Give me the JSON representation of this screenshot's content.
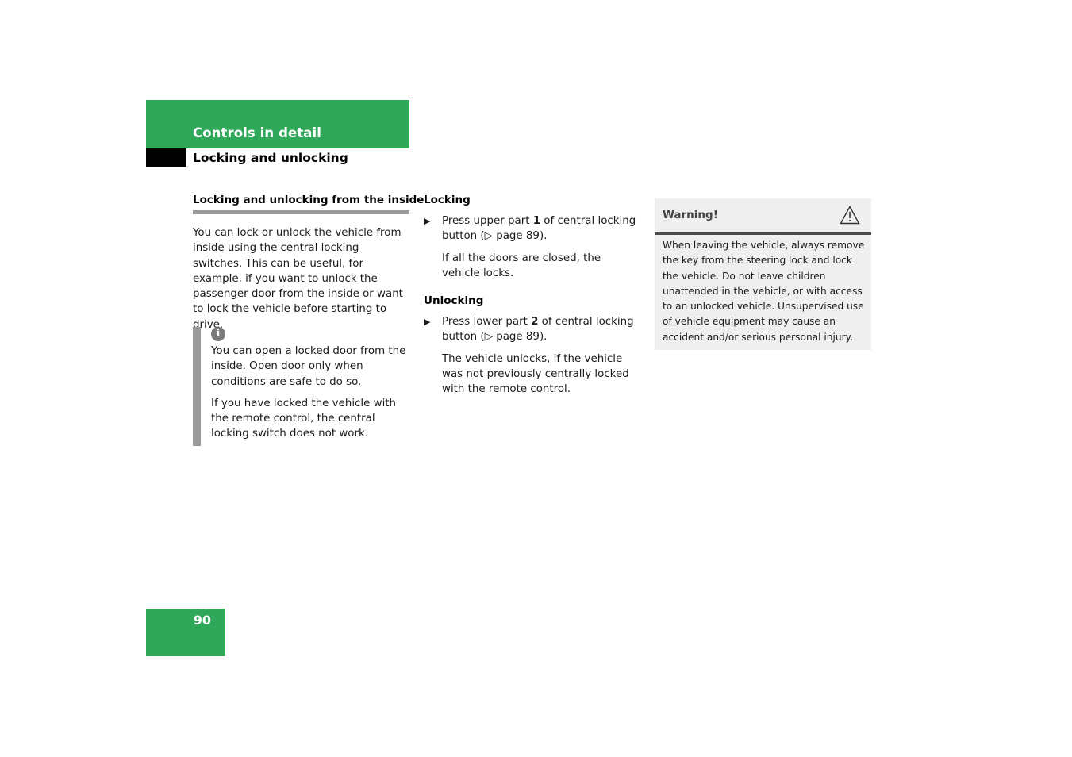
{
  "header": {
    "section_title": "Controls in detail",
    "subsection_title": "Locking and unlocking",
    "accent_color": "#2fa85a"
  },
  "left_column": {
    "heading": "Locking and unlocking from the inside",
    "intro": "You can lock or unlock the vehicle from inside using the central locking switches. This can be useful, for example, if you want to unlock the passenger door from the inside or want to lock the vehicle before starting to drive.",
    "note": {
      "icon": "info-icon",
      "paragraphs": [
        "You can open a locked door from the inside. Open door only when conditions are safe to do so.",
        "If you have locked the vehicle with the remote control, the central locking switch does not work."
      ]
    }
  },
  "middle_column": {
    "locking": {
      "heading": "Locking",
      "step_pre": "Press upper part ",
      "step_bold": "1",
      "step_post": " of central locking button (▷ page 89).",
      "result": "If all the doors are closed, the vehicle locks."
    },
    "unlocking": {
      "heading": "Unlocking",
      "step_pre": "Press lower part ",
      "step_bold": "2",
      "step_post": " of central locking button (▷ page 89).",
      "result": "The vehicle unlocks, if the vehicle was not previously centrally locked with the remote control."
    },
    "step_bullet": "▶"
  },
  "warning": {
    "title": "Warning!",
    "icon": "warning-triangle-icon",
    "text": "When leaving the vehicle, always remove the key from the steering lock and lock the vehicle. Do not leave children unattended in the vehicle, or with access to an unlocked vehicle. Unsupervised use of vehicle equipment may cause an accident and/or serious personal injury."
  },
  "footer": {
    "page_number": "90"
  }
}
